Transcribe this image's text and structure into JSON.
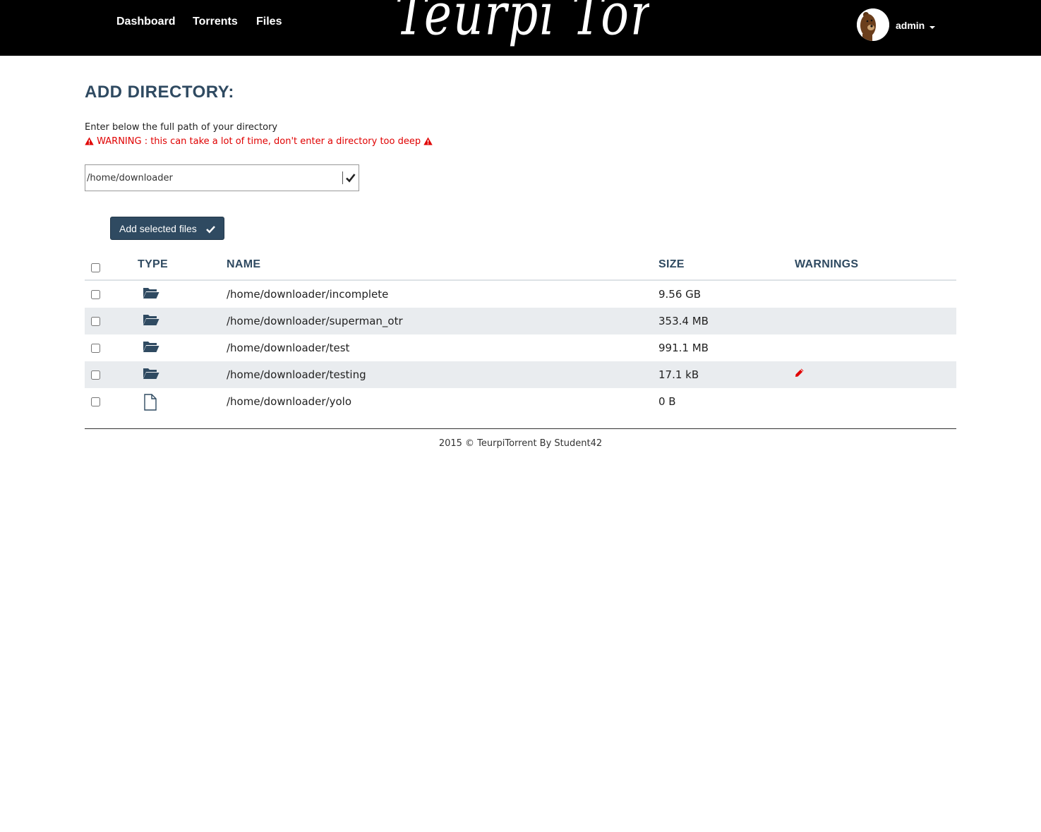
{
  "nav": {
    "links": [
      "Dashboard",
      "Torrents",
      "Files"
    ],
    "logo_text": "Teurpi Torrent",
    "user": {
      "name": "admin",
      "avatar_icon": "bear-avatar"
    }
  },
  "page": {
    "title": "ADD DIRECTORY:",
    "instructions": "Enter below the full path of your directory",
    "warning": "WARNING : this can take a lot of time, don't enter a directory too deep",
    "path_value": "/home/downloader",
    "add_button_label": "Add selected files"
  },
  "table": {
    "headers": {
      "type": "TYPE",
      "name": "NAME",
      "size": "SIZE",
      "warnings": "WARNINGS"
    },
    "rows": [
      {
        "type": "folder",
        "name": "/home/downloader/incomplete",
        "size": "9.56 GB",
        "warning": ""
      },
      {
        "type": "folder",
        "name": "/home/downloader/superman_otr",
        "size": "353.4 MB",
        "warning": ""
      },
      {
        "type": "folder",
        "name": "/home/downloader/test",
        "size": "991.1 MB",
        "warning": ""
      },
      {
        "type": "folder",
        "name": "/home/downloader/testing",
        "size": "17.1 kB",
        "warning": "pencil-icon"
      },
      {
        "type": "file",
        "name": "/home/downloader/yolo",
        "size": "0 B",
        "warning": ""
      }
    ]
  },
  "footer": {
    "text": "2015 © TeurpiTorrent By Student42"
  },
  "colors": {
    "navbar_bg": "#000000",
    "accent": "#2f4a61",
    "warning": "#e00000",
    "row_alt": "#e9ecef"
  }
}
